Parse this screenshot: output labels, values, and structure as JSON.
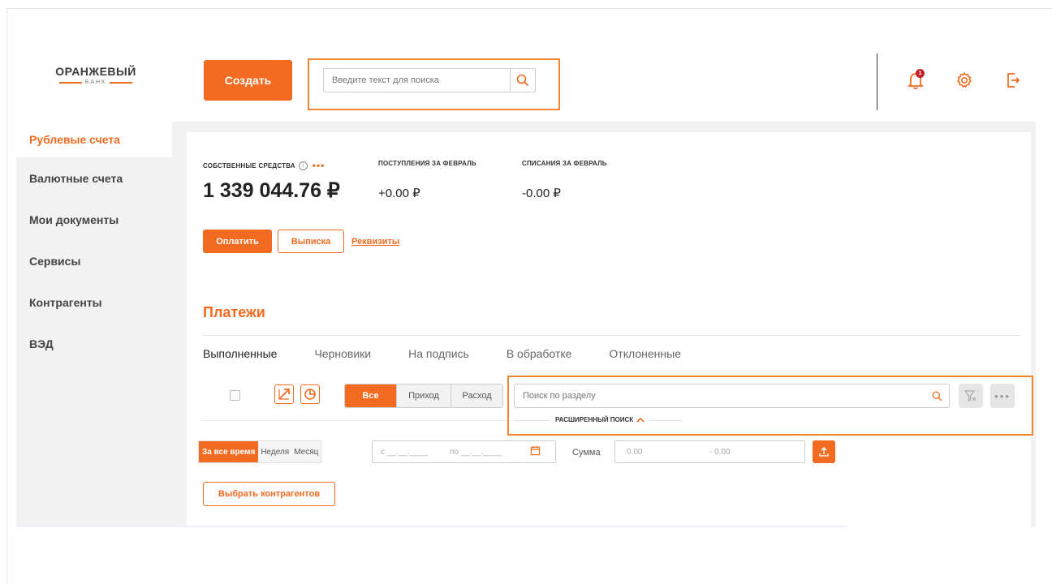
{
  "logo": {
    "main": "ОРАНЖЕВЫЙ",
    "sub": "БАНК"
  },
  "header": {
    "create_label": "Создать",
    "search_placeholder": "Введите текст для поиска",
    "notification_count": "1"
  },
  "sidebar": {
    "items": [
      {
        "label": "Рублевые счета",
        "active": true
      },
      {
        "label": "Валютные счета"
      },
      {
        "label": "Мои документы"
      },
      {
        "label": "Сервисы"
      },
      {
        "label": "Контрагенты"
      },
      {
        "label": "ВЭД"
      }
    ]
  },
  "balance": {
    "own_label": "СОБСТВЕННЫЕ СРЕДСТВА",
    "own_amount": "1 339 044.76 ₽",
    "income_label": "ПОСТУПЛЕНИЯ ЗА ФЕВРАЛЬ",
    "income_amount": "+0.00 ₽",
    "outgo_label": "СПИСАНИЯ ЗА ФЕВРАЛЬ",
    "outgo_amount": "-0.00 ₽",
    "more_dots": "•••"
  },
  "actions": {
    "pay": "Оплатить",
    "statement": "Выписка",
    "requisites": "Реквизиты"
  },
  "payments": {
    "title": "Платежи",
    "tabs": [
      {
        "label": "Выполненные",
        "active": true
      },
      {
        "label": "Черновики"
      },
      {
        "label": "На подпись"
      },
      {
        "label": "В обработке"
      },
      {
        "label": "Отклоненные"
      }
    ],
    "type_filter": [
      {
        "label": "Все",
        "active": true
      },
      {
        "label": "Приход"
      },
      {
        "label": "Расход"
      }
    ],
    "section_search_placeholder": "Поиск по разделу",
    "more_dots": "•••",
    "advanced_search": "РАСШИРЕННЫЙ ПОИСК",
    "period": [
      {
        "label": "За все время",
        "active": true
      },
      {
        "label": "Неделя"
      },
      {
        "label": "Месяц"
      }
    ],
    "date_from": "с __.__.____",
    "date_to": "по __.__.____",
    "sum_label": "Сумма",
    "sum_from": "0.00",
    "sum_to": "- 0.00",
    "choose_contractors": "Выбрать контрагентов"
  },
  "colors": {
    "accent": "#f26b21",
    "highlight": "#f2852f",
    "badge": "#c3202a"
  }
}
